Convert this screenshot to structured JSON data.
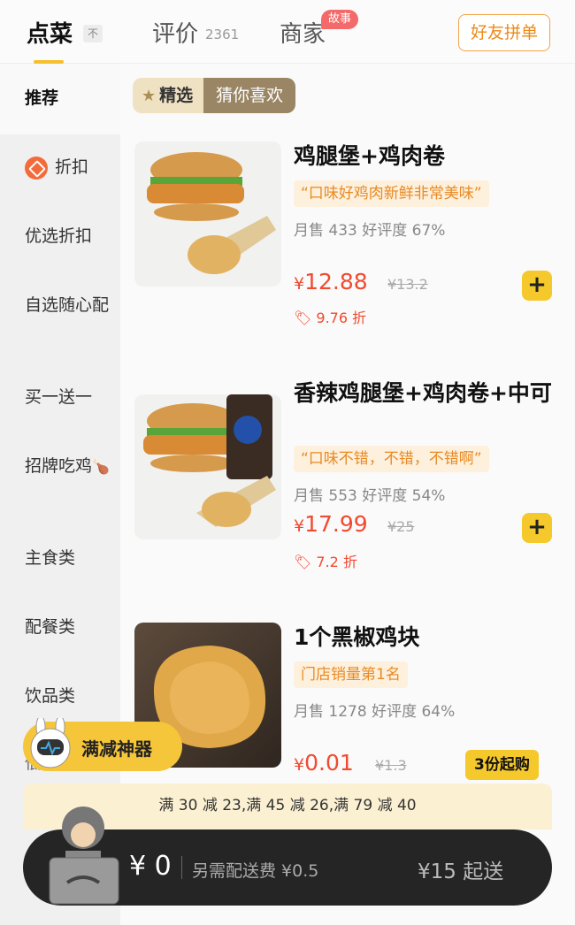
{
  "tabs": {
    "order": "点菜",
    "sort_hint": "不",
    "reviews": "评价",
    "reviews_count": "2361",
    "merchant": "商家",
    "story_badge": "故事",
    "friend_button": "好友拼单"
  },
  "sidebar": {
    "items": [
      {
        "label": "推荐"
      },
      {
        "label": "折扣"
      },
      {
        "label": "优选折扣"
      },
      {
        "label": "自选随心配"
      },
      {
        "label": "买一送一"
      },
      {
        "label": "招牌吃鸡"
      },
      {
        "label": "主食类"
      },
      {
        "label": "配餐类"
      },
      {
        "label": "饮品类"
      },
      {
        "label": "低价折扣"
      }
    ]
  },
  "filters": {
    "featured": "精选",
    "guess": "猜你喜欢"
  },
  "items": [
    {
      "title": "鸡腿堡+鸡肉卷",
      "tag": "“口味好鸡肉新鲜非常美味”",
      "stats": "月售 433   好评度 67%",
      "price_symbol": "¥",
      "price": "12.88",
      "original_price": "¥13.2",
      "discount": "9.76 折",
      "add": "+"
    },
    {
      "title": "香辣鸡腿堡+鸡肉卷+中可",
      "tag": "“口味不错，不错，不错啊”",
      "stats": "月售 553   好评度 54%",
      "price_symbol": "¥",
      "price": "17.99",
      "original_price": "¥25",
      "discount": "7.2 折",
      "add": "+"
    },
    {
      "title": "1个黑椒鸡块",
      "tag": "门店销量第1名",
      "stats": "月售 1278   好评度 64%",
      "price_symbol": "¥",
      "price": "0.01",
      "original_price": "¥1.3",
      "min_order": "3份起购"
    }
  ],
  "promo": {
    "label": "满减神器"
  },
  "offer_bar": {
    "text": "满 30 减 23,满 45 减 26,满 79 减 40"
  },
  "cart": {
    "total": "¥ 0",
    "delivery_fee": "另需配送费 ¥0.5",
    "min_order": "¥15 起送"
  },
  "colors": {
    "accent_yellow": "#f5c82b",
    "price_red": "#f04a30",
    "tag_orange": "#e98a24",
    "cart_dark": "#252525"
  }
}
